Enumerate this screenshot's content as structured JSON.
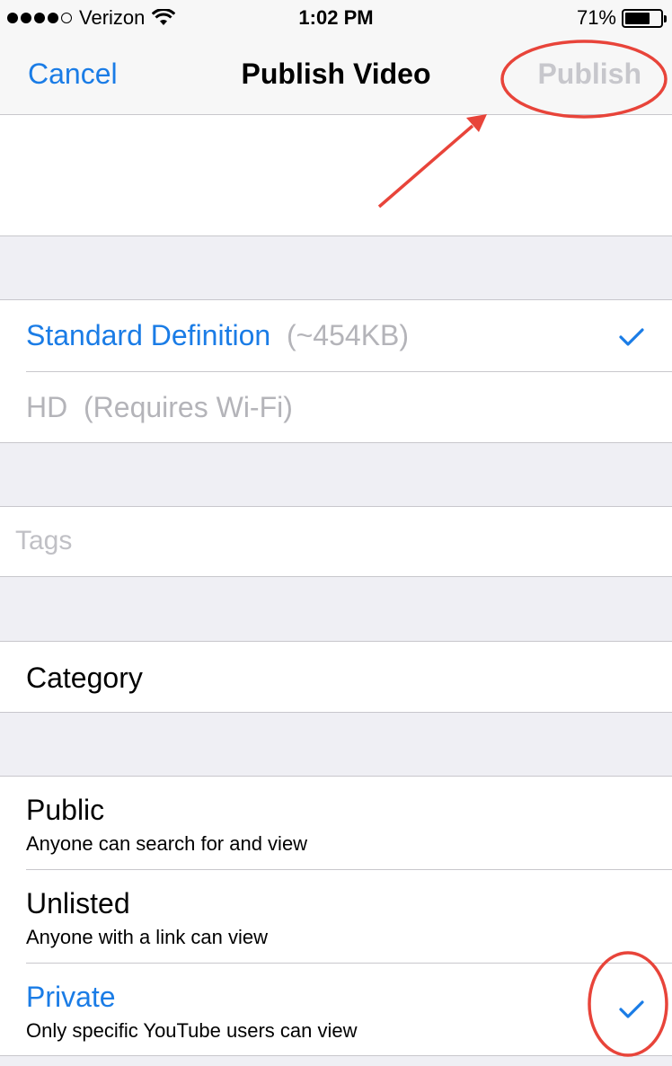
{
  "status_bar": {
    "carrier": "Verizon",
    "time": "1:02 PM",
    "battery_percent": "71%",
    "battery_level": 0.71,
    "signal_icon": "signal-dots-icon",
    "wifi_icon": "wifi-icon"
  },
  "nav": {
    "cancel_label": "Cancel",
    "title": "Publish Video",
    "publish_label": "Publish"
  },
  "quality": {
    "options": [
      {
        "label": "Standard Definition",
        "detail": "(~454KB)",
        "selected": true
      },
      {
        "label": "HD",
        "detail": "(Requires Wi-Fi)",
        "selected": false
      }
    ]
  },
  "tags": {
    "placeholder": "Tags",
    "value": ""
  },
  "category": {
    "label": "Category"
  },
  "privacy": {
    "options": [
      {
        "title": "Public",
        "subtitle": "Anyone can search for and view",
        "selected": false
      },
      {
        "title": "Unlisted",
        "subtitle": "Anyone with a link can view",
        "selected": false
      },
      {
        "title": "Private",
        "subtitle": "Only specific YouTube users can view",
        "selected": true
      }
    ]
  },
  "colors": {
    "accent": "#1a7ce6",
    "disabled": "#c7c7cc",
    "annotation": "#e8443a",
    "background": "#efeff4"
  }
}
